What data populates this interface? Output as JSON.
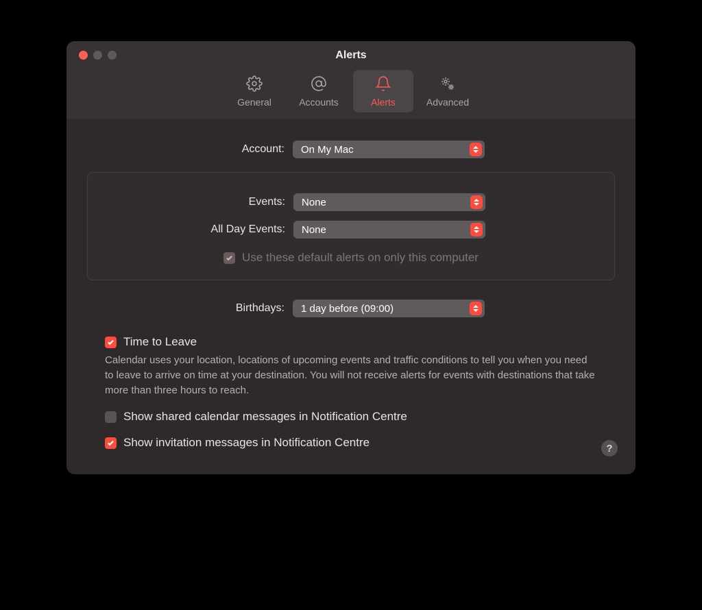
{
  "window": {
    "title": "Alerts"
  },
  "toolbar": {
    "general": "General",
    "accounts": "Accounts",
    "alerts": "Alerts",
    "advanced": "Advanced"
  },
  "account": {
    "label": "Account:",
    "value": "On My Mac"
  },
  "defaults": {
    "events_label": "Events:",
    "events_value": "None",
    "allday_label": "All Day Events:",
    "allday_value": "None",
    "only_this_computer": "Use these default alerts on only this computer"
  },
  "birthdays": {
    "label": "Birthdays:",
    "value": "1 day before (09:00)"
  },
  "time_to_leave": {
    "label": "Time to Leave",
    "desc": "Calendar uses your location, locations of upcoming events and traffic conditions to tell you when you need to leave to arrive on time at your destination. You will not receive alerts for events with destinations that take more than three hours to reach."
  },
  "show_shared": "Show shared calendar messages in Notification Centre",
  "show_invitation": "Show invitation messages in Notification Centre",
  "help": "?"
}
